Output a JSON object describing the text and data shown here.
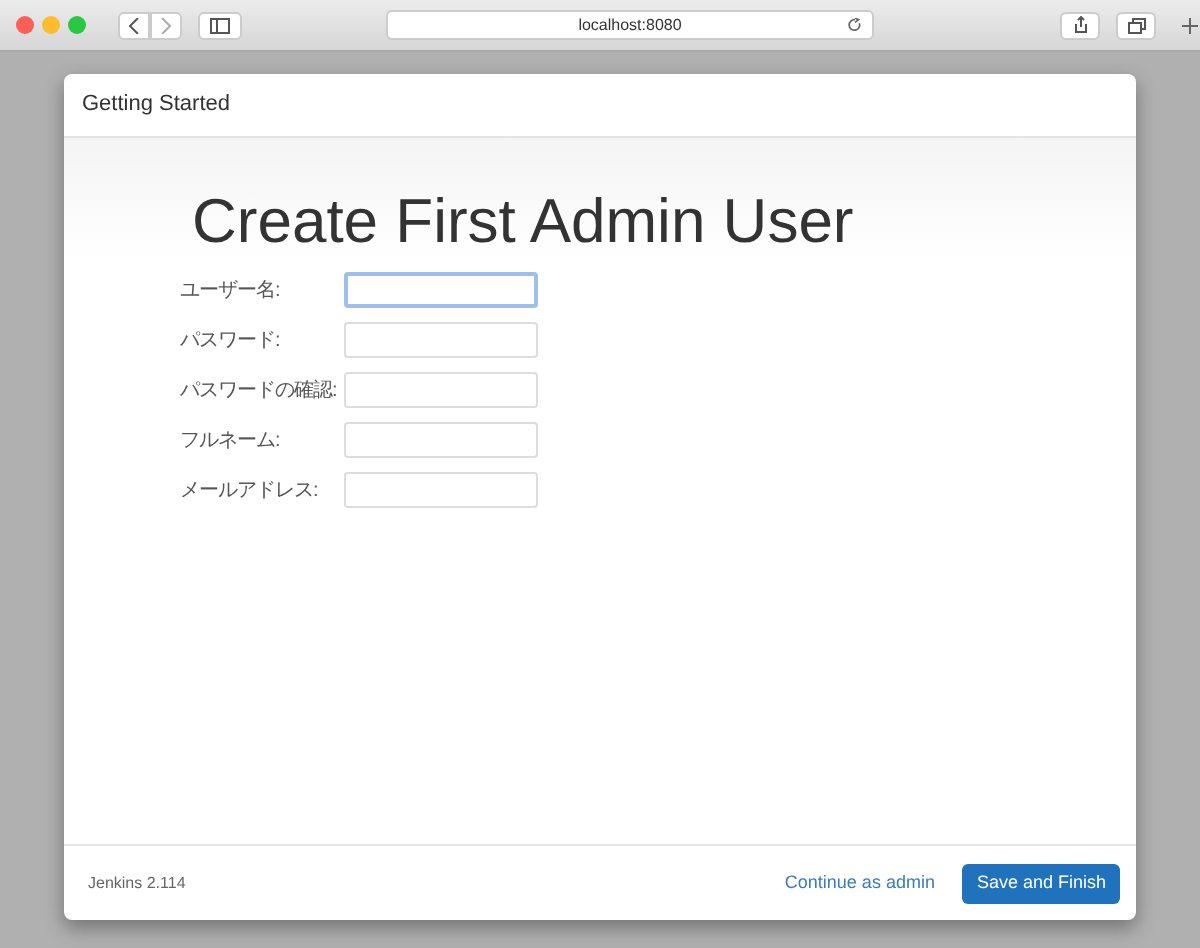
{
  "browser": {
    "address": "localhost:8080"
  },
  "dialog": {
    "title": "Getting Started",
    "heading": "Create First Admin User",
    "fields": [
      {
        "label": "ユーザー名:",
        "focused": true
      },
      {
        "label": "パスワード:",
        "focused": false
      },
      {
        "label": "パスワードの確認:",
        "focused": false
      },
      {
        "label": "フルネーム:",
        "focused": false
      },
      {
        "label": "メールアドレス:",
        "focused": false
      }
    ],
    "footer": {
      "version": "Jenkins 2.114",
      "link": "Continue as admin",
      "button": "Save and Finish"
    }
  }
}
